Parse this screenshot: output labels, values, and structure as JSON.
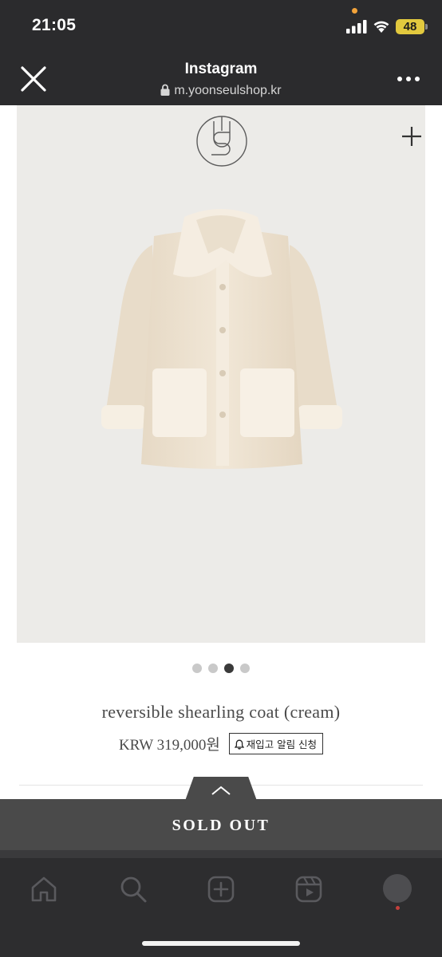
{
  "status_bar": {
    "time": "21:05",
    "battery": "48",
    "icons": [
      "signal-icon",
      "wifi-icon",
      "battery-icon"
    ]
  },
  "browser": {
    "title": "Instagram",
    "url": "m.yoonseulshop.kr",
    "icons": [
      "close-icon",
      "lock-icon",
      "more-icon"
    ]
  },
  "product": {
    "title": "reversible shearling coat (cream)",
    "price": "KRW 319,000원",
    "restock_button": "재입고 알림 신청",
    "image_count": 4,
    "active_image": 3,
    "icons": [
      "brand-logo-icon",
      "plus-icon",
      "bell-icon"
    ]
  },
  "sold_out": {
    "label": "SOLD OUT",
    "icon": "chevron-up-icon"
  },
  "instagram_tabs": {
    "items": [
      "home-icon",
      "search-icon",
      "create-icon",
      "reels-icon",
      "profile-avatar"
    ]
  },
  "colors": {
    "chrome": "#2b2b2d",
    "image_bg": "#ecebe8",
    "coat": "#eee3d2",
    "sold_out_bar": "#4a4a4a",
    "battery": "#e2c93e"
  }
}
